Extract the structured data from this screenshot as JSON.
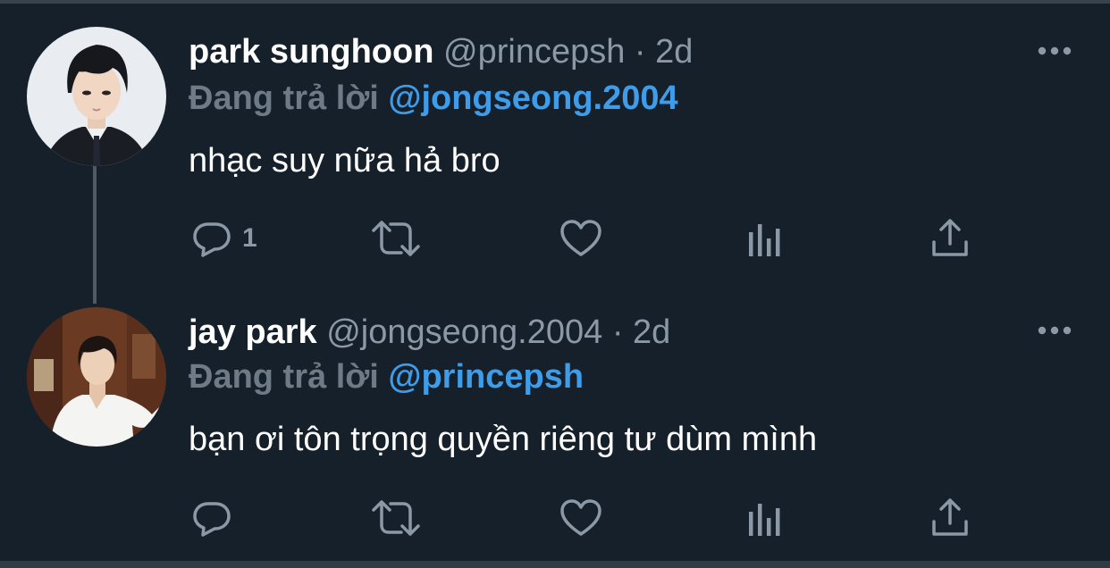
{
  "colors": {
    "background": "#15202b",
    "icon": "#8b98a5",
    "mention": "#3e9ce8",
    "reply_prefix": "#6e7a86"
  },
  "tweets": [
    {
      "display_name": "park sunghoon",
      "handle": "@princepsh",
      "dot": "·",
      "time": "2d",
      "reply_prefix": "Đang trả lời",
      "reply_to": "@jongseong.2004",
      "text": "nhạc suy nữa hả bro",
      "reply_count": "1",
      "avatar_icon": "avatar-portrait-suit",
      "actions": [
        "reply-icon",
        "retweet-icon",
        "like-icon",
        "analytics-icon",
        "share-icon"
      ]
    },
    {
      "display_name": "jay park",
      "handle": "@jongseong.2004",
      "dot": "·",
      "time": "2d",
      "reply_prefix": "Đang trả lời",
      "reply_to": "@princepsh",
      "text": "bạn ơi tôn trọng quyền riêng tư dùm mình",
      "reply_count": "",
      "avatar_icon": "avatar-portrait-white-shirt",
      "actions": [
        "reply-icon",
        "retweet-icon",
        "like-icon",
        "analytics-icon",
        "share-icon"
      ]
    }
  ]
}
